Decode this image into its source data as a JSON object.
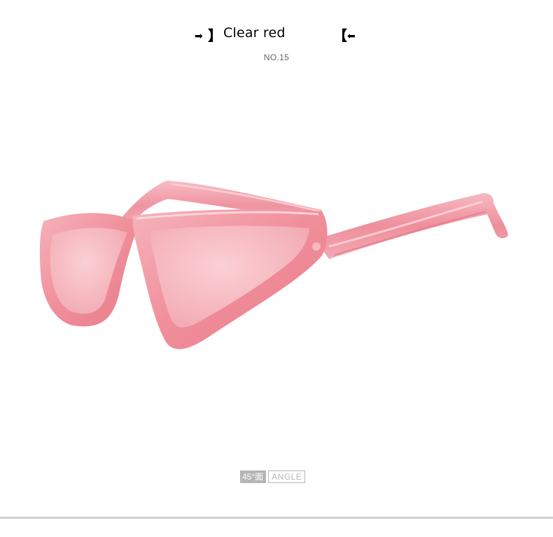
{
  "header": {
    "title": "Clear red",
    "left_bracket": "】",
    "right_bracket": "【",
    "arrow_right": "➡",
    "arrow_left": "⬅"
  },
  "model_number": "NO.15",
  "product": {
    "icon": "cat-eye-sunglasses",
    "frame_color": "#f29aa6",
    "lens_color": "#f6b7bf"
  },
  "angle": {
    "degree_text": "45°面",
    "label": "ANGLE"
  }
}
